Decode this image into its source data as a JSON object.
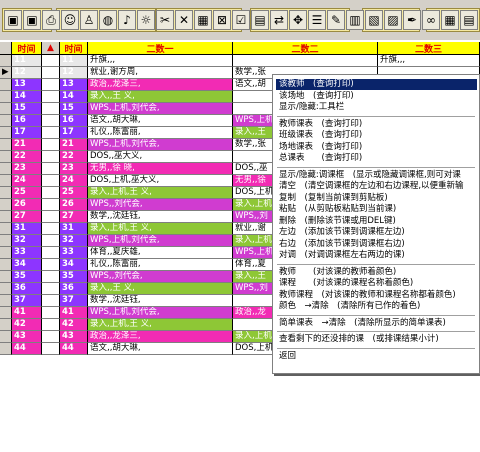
{
  "toolbar": {
    "buttons": [
      "disk-icon",
      "disk-icon",
      "printer-icon",
      "users-icon",
      "user-icon",
      "globe-icon",
      "bell-icon",
      "lightbulb-icon",
      "scissors-icon",
      "cross-icon",
      "grid-cut-icon",
      "grid-cross-icon",
      "checklist-icon",
      "grid-icon",
      "arrows-icon",
      "move-icon",
      "list-icon",
      "broom-icon",
      "book-stack-icon",
      "book-icon",
      "folder-icon",
      "pen-icon",
      "binoculars-icon",
      "grid-report-icon",
      "document-icon"
    ]
  },
  "grid": {
    "header": {
      "time": "时间",
      "col1": "二数一",
      "col2": "二数二",
      "col3": "二数三"
    },
    "rows": [
      {
        "period": "11",
        "c1": "升旗,,,",
        "c2": "",
        "c3": "升旗,,,",
        "hl": "#e8e8e8",
        "bg1": "#ffffff",
        "bg2": "#ffffff",
        "bg3": "#ffffff",
        "fg1": "#000000",
        "fg2": "#000000"
      },
      {
        "period": "12",
        "c1": "就业,谢方周,",
        "c2": "数学,,张",
        "c3": "",
        "hl": "#e8e8e8",
        "bg1": "#ffffff",
        "bg2": "#ffffff",
        "bg3": "#ffffff",
        "fg1": "#000000",
        "fg2": "#000000"
      },
      {
        "period": "13",
        "c1": "政治,,龙泽三,",
        "c2": "语文,,胡",
        "c3": "",
        "hl": "#8d35ff",
        "bg1": "#f22bb4",
        "bg2": "#ffffff",
        "bg3": "#ffffff",
        "fg1": "#ffffff",
        "fg2": "#000000"
      },
      {
        "period": "14",
        "c1": "录入,,王 义,",
        "c2": "",
        "c3": "",
        "hl": "#8d35ff",
        "bg1": "#8ec736",
        "bg2": "#ffffff",
        "bg3": "#ffffff",
        "fg1": "#ffffff",
        "fg2": "#000000"
      },
      {
        "period": "15",
        "c1": "WPS,上机,刘代会,",
        "c2": "",
        "c3": "",
        "hl": "#8d35ff",
        "bg1": "#d03cd0",
        "bg2": "#ffffff",
        "bg3": "#ffffff",
        "fg1": "#ffffff",
        "fg2": "#000000"
      },
      {
        "period": "16",
        "c1": "语文,,胡大琳,",
        "c2": "WPS,上机",
        "c3": "",
        "hl": "#8d35ff",
        "bg1": "#ffffff",
        "bg2": "#d03cd0",
        "bg3": "#ffffff",
        "fg1": "#000000",
        "fg2": "#ffffff"
      },
      {
        "period": "17",
        "c1": "礼仪,,陈富丽,",
        "c2": "录入,,王",
        "c3": "",
        "hl": "#8d35ff",
        "bg1": "#ffffff",
        "bg2": "#8ec736",
        "bg3": "#ffffff",
        "fg1": "#000000",
        "fg2": "#ffffff"
      },
      {
        "period": "21",
        "c1": "WPS,上机,刘代会,",
        "c2": "数学,,张",
        "c3": "",
        "hl": "#f22bb4",
        "bg1": "#d03cd0",
        "bg2": "#ffffff",
        "bg3": "#ffffff",
        "fg1": "#ffffff",
        "fg2": "#000000"
      },
      {
        "period": "22",
        "c1": "DOS,,巫大义,",
        "c2": "",
        "c3": "",
        "hl": "#f22bb4",
        "bg1": "#ffffff",
        "bg2": "#ffffff",
        "bg3": "#ffffff",
        "fg1": "#000000",
        "fg2": "#000000"
      },
      {
        "period": "23",
        "c1": "无男,,徐 晓,",
        "c2": "DOS,,巫",
        "c3": "",
        "hl": "#f22bb4",
        "bg1": "#f22bb4",
        "bg2": "#ffffff",
        "bg3": "#ffffff",
        "fg1": "#ffffff",
        "fg2": "#000000"
      },
      {
        "period": "24",
        "c1": "DOS,上机,巫大义,",
        "c2": "无男,,徐",
        "c3": "",
        "hl": "#f22bb4",
        "bg1": "#ffffff",
        "bg2": "#f22bb4",
        "bg3": "#ffffff",
        "fg1": "#000000",
        "fg2": "#ffffff"
      },
      {
        "period": "25",
        "c1": "录入,上机,王 义,",
        "c2": "DOS,上机",
        "c3": "",
        "hl": "#f22bb4",
        "bg1": "#8ec736",
        "bg2": "#ffffff",
        "bg3": "#ffffff",
        "fg1": "#ffffff",
        "fg2": "#000000"
      },
      {
        "period": "26",
        "c1": "WPS,,刘代会,",
        "c2": "录入,上机",
        "c3": "",
        "hl": "#f22bb4",
        "bg1": "#d03cd0",
        "bg2": "#8ec736",
        "bg3": "#ffffff",
        "fg1": "#ffffff",
        "fg2": "#ffffff"
      },
      {
        "period": "27",
        "c1": "数学,,沈廷钰,",
        "c2": "WPS,,刘",
        "c3": "",
        "hl": "#f22bb4",
        "bg1": "#ffffff",
        "bg2": "#d03cd0",
        "bg3": "#ffffff",
        "fg1": "#000000",
        "fg2": "#ffffff"
      },
      {
        "period": "31",
        "c1": "录入,上机,王 义,",
        "c2": "就业,,谢",
        "c3": "",
        "hl": "#8d35ff",
        "bg1": "#8ec736",
        "bg2": "#ffffff",
        "bg3": "#ffffff",
        "fg1": "#ffffff",
        "fg2": "#000000"
      },
      {
        "period": "32",
        "c1": "WPS,上机,刘代会,",
        "c2": "录入,上机",
        "c3": "",
        "hl": "#8d35ff",
        "bg1": "#d03cd0",
        "bg2": "#8ec736",
        "bg3": "#ffffff",
        "fg1": "#ffffff",
        "fg2": "#ffffff"
      },
      {
        "period": "33",
        "c1": "体育,,夏庆雄,",
        "c2": "WPS,上机",
        "c3": "",
        "hl": "#8d35ff",
        "bg1": "#ffffff",
        "bg2": "#d03cd0",
        "bg3": "#ffffff",
        "fg1": "#000000",
        "fg2": "#ffffff"
      },
      {
        "period": "34",
        "c1": "礼仪,,陈富丽,",
        "c2": "体育,,夏",
        "c3": "",
        "hl": "#8d35ff",
        "bg1": "#ffffff",
        "bg2": "#ffffff",
        "bg3": "#ffffff",
        "fg1": "#000000",
        "fg2": "#000000"
      },
      {
        "period": "35",
        "c1": "WPS,,刘代会,",
        "c2": "录入,,王",
        "c3": "",
        "hl": "#8d35ff",
        "bg1": "#d03cd0",
        "bg2": "#8ec736",
        "bg3": "#ffffff",
        "fg1": "#ffffff",
        "fg2": "#ffffff"
      },
      {
        "period": "36",
        "c1": "录入,,王 义,",
        "c2": "WPS,,刘",
        "c3": "",
        "hl": "#8d35ff",
        "bg1": "#8ec736",
        "bg2": "#d03cd0",
        "bg3": "#ffffff",
        "fg1": "#ffffff",
        "fg2": "#ffffff"
      },
      {
        "period": "37",
        "c1": "数学,,沈廷钰,",
        "c2": "",
        "c3": "",
        "hl": "#8d35ff",
        "bg1": "#ffffff",
        "bg2": "#ffffff",
        "bg3": "#ffffff",
        "fg1": "#000000",
        "fg2": "#000000"
      },
      {
        "period": "41",
        "c1": "WPS,上机,刘代会,",
        "c2": "政治,,龙",
        "c3": "",
        "hl": "#f22bb4",
        "bg1": "#d03cd0",
        "bg2": "#f22bb4",
        "bg3": "#ffffff",
        "fg1": "#ffffff",
        "fg2": "#ffffff"
      },
      {
        "period": "42",
        "c1": "录入,上机,王 义,",
        "c2": "",
        "c3": "",
        "hl": "#f22bb4",
        "bg1": "#8ec736",
        "bg2": "#ffffff",
        "bg3": "#ffffff",
        "fg1": "#ffffff",
        "fg2": "#000000"
      },
      {
        "period": "43",
        "c1": "政治,,龙泽三,",
        "c2": "录入,上机",
        "c3": "",
        "hl": "#f22bb4",
        "bg1": "#f22bb4",
        "bg2": "#8ec736",
        "bg3": "#ffffff",
        "fg1": "#ffffff",
        "fg2": "#ffffff"
      },
      {
        "period": "44",
        "c1": "语文,,胡大琳,",
        "c2": "DOS,上机",
        "c3": "",
        "hl": "#f22bb4",
        "bg1": "#ffffff",
        "bg2": "#ffffff",
        "bg3": "#ffffff",
        "fg1": "#000000",
        "fg2": "#000000"
      }
    ]
  },
  "context_menu": {
    "items": [
      {
        "label": "该教师　(查询打印)",
        "highlight": true
      },
      {
        "label": "该场地　(查询打印)"
      },
      {
        "label": "显示/隐藏:工具栏"
      },
      {
        "sep": true
      },
      {
        "label": "教师课表　(查询打印)"
      },
      {
        "label": "班级课表　(查询打印)"
      },
      {
        "label": "场地课表　(查询打印)"
      },
      {
        "label": "总课表　　(查询打印)"
      },
      {
        "sep": true
      },
      {
        "label": "显示/隐藏:调课框　(显示或隐藏调课框,则可对课"
      },
      {
        "label": "清空　(清空调课框的左边和右边课程,以便重新输"
      },
      {
        "label": "复制　(复制当前课到剪贴板)"
      },
      {
        "label": "粘贴　(从剪贴板粘贴到当前课)"
      },
      {
        "label": "删除　(删除该节课或用DEL键)"
      },
      {
        "label": "左边　(添加该节课到调课框左边)"
      },
      {
        "label": "右边　(添加该节课到调课框右边)"
      },
      {
        "label": "对调　(对调调课框左右两边的课)"
      },
      {
        "sep": true
      },
      {
        "label": "教师　　(对该课的教师着颜色)"
      },
      {
        "label": "课程　　(对该课的课程名称着颜色)"
      },
      {
        "label": "教师课程　(对该课的教师和课程名称都着颜色)"
      },
      {
        "label": "颜色　→清除　(清除所有已作的着色)"
      },
      {
        "sep": true
      },
      {
        "label": "简单课表　→清除　(清除所显示的简单课表)"
      },
      {
        "sep": true
      },
      {
        "label": "查看剩下的还没排的课　(或排课结果小计)"
      },
      {
        "sep": true
      },
      {
        "label": "返回"
      }
    ]
  }
}
